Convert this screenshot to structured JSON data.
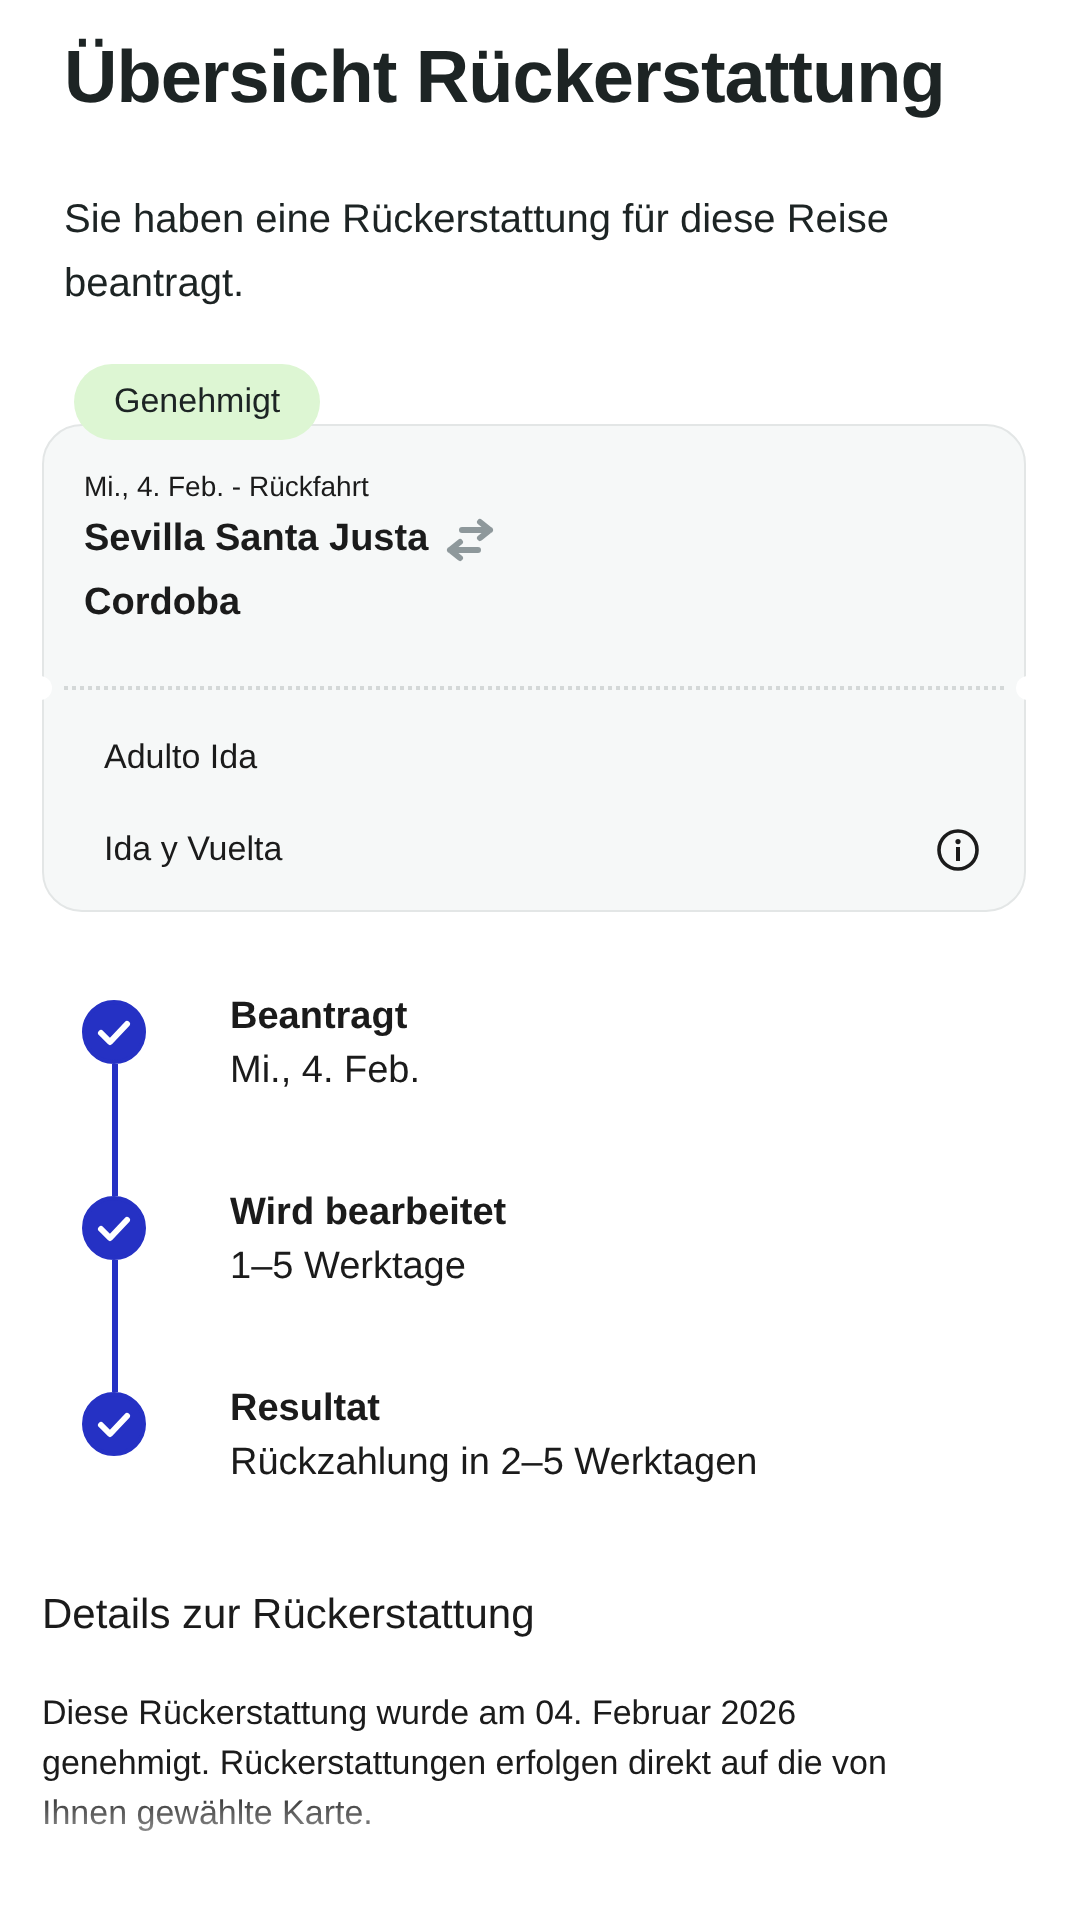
{
  "title": "Übersicht Rückerstattung",
  "intro": "Sie haben eine Rückerstattung für diese Reise beantragt.",
  "status_badge": {
    "label": "Genehmigt",
    "kind": "approved"
  },
  "ticket": {
    "date_line": "Mi., 4. Feb. - Rückfahrt",
    "origin": "Sevilla Santa Justa",
    "destination": "Cordoba",
    "passengers": [
      {
        "label": "Adulto Ida",
        "info": false
      },
      {
        "label": "Ida y Vuelta",
        "info": true
      }
    ]
  },
  "steps": [
    {
      "title": "Beantragt",
      "detail": "Mi., 4. Feb.",
      "done": true
    },
    {
      "title": "Wird bearbeitet",
      "detail": "1–5 Werktage",
      "done": true
    },
    {
      "title": "Resultat",
      "detail": "Rückzahlung in 2–5 Werktagen",
      "done": true
    }
  ],
  "details": {
    "heading": "Details zur Rückerstattung",
    "text": "Diese Rückerstattung wurde am 04. Februar 2026 genehmigt. Rückerstattungen erfolgen direkt auf die von Ihnen gewählte Karte."
  }
}
